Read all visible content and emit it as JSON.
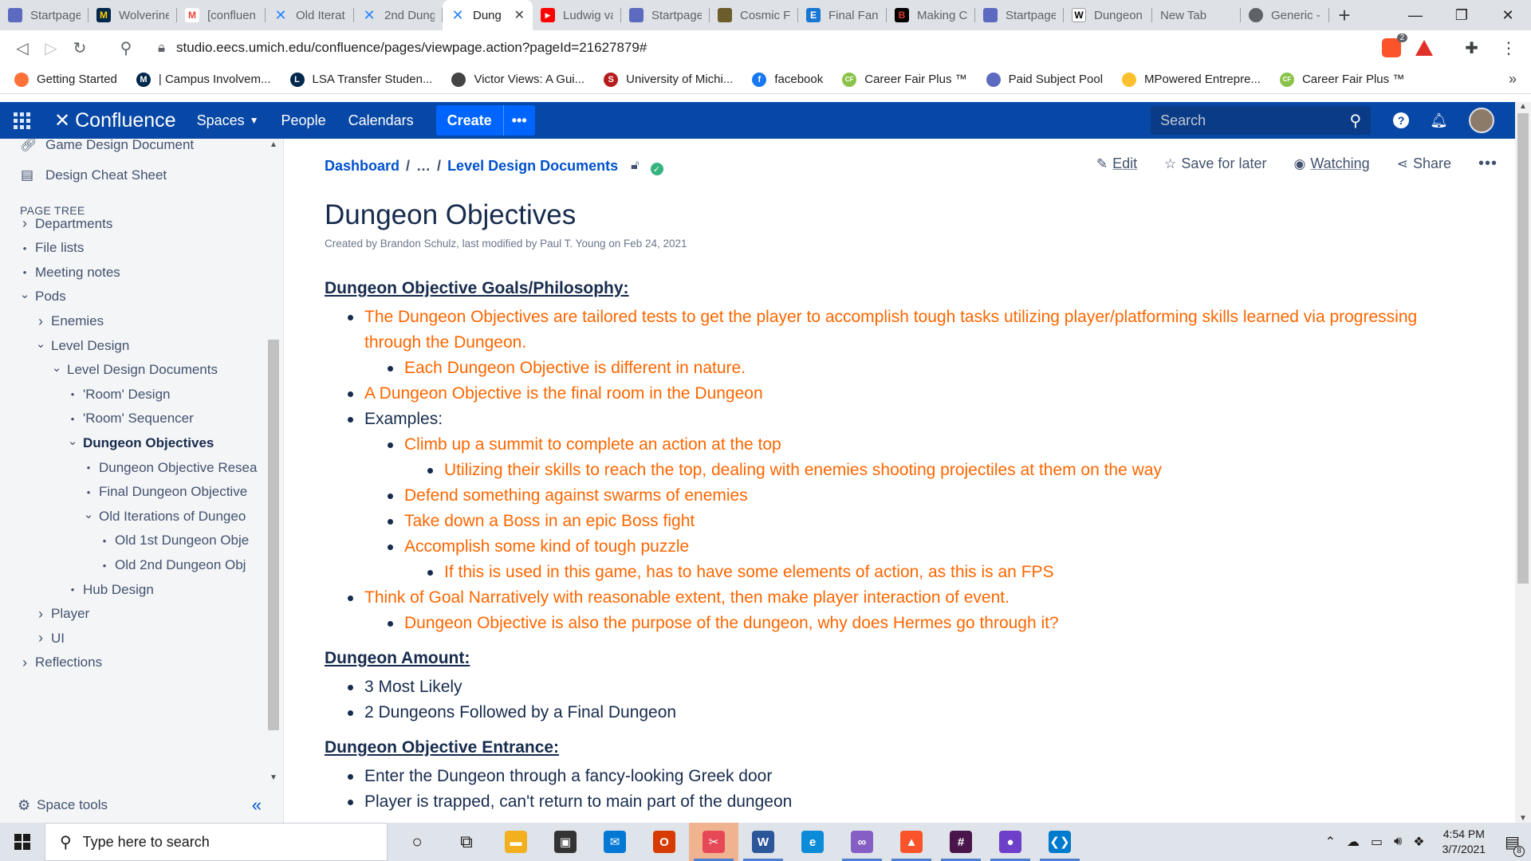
{
  "browser": {
    "tabs": [
      {
        "label": "Startpage",
        "icon": "startpage-icon",
        "color": "#5c6bc0"
      },
      {
        "label": "Wolverine",
        "icon": "michigan-icon",
        "color": "#00274c"
      },
      {
        "label": "[confluen",
        "icon": "gmail-icon",
        "color": "#ea4335"
      },
      {
        "label": "Old Iterat",
        "icon": "confluence-icon",
        "color": "#2684ff"
      },
      {
        "label": "2nd Dung",
        "icon": "confluence-icon",
        "color": "#2684ff"
      },
      {
        "label": "Dung",
        "icon": "confluence-icon",
        "color": "#2684ff",
        "active": true
      },
      {
        "label": "Ludwig va",
        "icon": "youtube-icon",
        "color": "#ff0000"
      },
      {
        "label": "Startpage",
        "icon": "startpage-icon",
        "color": "#5c6bc0"
      },
      {
        "label": "Cosmic Fa",
        "icon": "cosmic-icon",
        "color": "#6d5d2c"
      },
      {
        "label": "Final Fant",
        "icon": "e-icon",
        "color": "#1976d2"
      },
      {
        "label": "Making C",
        "icon": "b-icon",
        "color": "#c62828"
      },
      {
        "label": "Startpage",
        "icon": "startpage-icon",
        "color": "#5c6bc0"
      },
      {
        "label": "Dungeon",
        "icon": "wikipedia-icon",
        "color": "#ffffff"
      },
      {
        "label": "New Tab",
        "icon": "",
        "color": ""
      },
      {
        "label": "Generic -",
        "icon": "globe-icon",
        "color": "#5f6368"
      }
    ],
    "close_glyph": "✕",
    "new_tab_glyph": "+",
    "window_controls": {
      "minimize": "—",
      "maximize": "❐",
      "close": "✕"
    },
    "url": "studio.eecs.umich.edu/confluence/pages/viewpage.action?pageId=21627879#",
    "brave_badge": "2",
    "bookmarks": [
      {
        "label": "Getting Started",
        "icon": "firefox-icon",
        "color": "#ff7139",
        "glyph": ""
      },
      {
        "label": "| Campus Involvem...",
        "icon": "michigan-icon",
        "color": "#00274c",
        "glyph": "M"
      },
      {
        "label": "LSA Transfer Studen...",
        "icon": "lsa-icon",
        "color": "#00274c",
        "glyph": "L"
      },
      {
        "label": "Victor Views: A Gui...",
        "icon": "globe-icon",
        "color": "#444444",
        "glyph": ""
      },
      {
        "label": "University of Michi...",
        "icon": "umich-icon",
        "color": "#b71c1c",
        "glyph": "S"
      },
      {
        "label": "facebook",
        "icon": "facebook-icon",
        "color": "#1877f2",
        "glyph": "f"
      },
      {
        "label": "Career Fair Plus ™",
        "icon": "careerfair-icon",
        "color": "#8bc34a",
        "glyph": "CF"
      },
      {
        "label": "Paid Subject Pool",
        "icon": "subjectpool-icon",
        "color": "#5c6bc0",
        "glyph": ""
      },
      {
        "label": "MPowered Entrepre...",
        "icon": "mpowered-icon",
        "color": "#fbc02d",
        "glyph": ""
      },
      {
        "label": "Career Fair Plus ™",
        "icon": "careerfair-icon",
        "color": "#8bc34a",
        "glyph": "CF"
      }
    ],
    "bookmarks_more": "»"
  },
  "confluence": {
    "logo_text": "Confluence",
    "nav": {
      "spaces": "Spaces",
      "people": "People",
      "calendars": "Calendars",
      "create": "Create",
      "create_more": "•••"
    },
    "search_placeholder": "Search",
    "brand_color": "#0747a6"
  },
  "sidebar": {
    "top_items": [
      {
        "label": "Game Design Document",
        "icon": "link-icon"
      },
      {
        "label": "Design Cheat Sheet",
        "icon": "document-icon"
      }
    ],
    "page_tree_heading": "PAGE TREE",
    "tree": [
      {
        "label": "Departments",
        "marker": "›",
        "depth": 0
      },
      {
        "label": "File lists",
        "marker": "•",
        "depth": 0
      },
      {
        "label": "Meeting notes",
        "marker": "•",
        "depth": 0
      },
      {
        "label": "Pods",
        "marker": "⌄",
        "depth": 0
      },
      {
        "label": "Enemies",
        "marker": "›",
        "depth": 1
      },
      {
        "label": "Level Design",
        "marker": "⌄",
        "depth": 1
      },
      {
        "label": "Level Design Documents",
        "marker": "⌄",
        "depth": 2
      },
      {
        "label": "'Room' Design",
        "marker": "•",
        "depth": 3
      },
      {
        "label": "'Room' Sequencer",
        "marker": "•",
        "depth": 3
      },
      {
        "label": "Dungeon Objectives",
        "marker": "⌄",
        "depth": 3,
        "current": true
      },
      {
        "label": "Dungeon Objective Resea",
        "marker": "•",
        "depth": 4
      },
      {
        "label": "Final Dungeon Objective",
        "marker": "•",
        "depth": 4
      },
      {
        "label": "Old Iterations of Dungeo",
        "marker": "⌄",
        "depth": 4
      },
      {
        "label": "Old 1st Dungeon Obje",
        "marker": "•",
        "depth": 5
      },
      {
        "label": "Old 2nd Dungeon Obj",
        "marker": "•",
        "depth": 5
      },
      {
        "label": "Hub Design",
        "marker": "•",
        "depth": 3
      },
      {
        "label": "Player",
        "marker": "›",
        "depth": 1
      },
      {
        "label": "UI",
        "marker": "›",
        "depth": 1
      },
      {
        "label": "Reflections",
        "marker": "›",
        "depth": 0
      }
    ],
    "space_tools": "Space tools",
    "collapse_glyph": "«"
  },
  "page": {
    "breadcrumbs": [
      {
        "label": "Dashboard"
      },
      {
        "label": "…"
      },
      {
        "label": "Level Design Documents"
      }
    ],
    "actions": {
      "edit": "Edit",
      "save": "Save for later",
      "watch": "Watching",
      "share": "Share",
      "more": "•••"
    },
    "title": "Dungeon Objectives",
    "byline": "Created by Brandon Schulz, last modified by Paul T. Young on Feb 24, 2021",
    "sections": [
      {
        "heading": "Dungeon Objective Goals/Philosophy:",
        "items": [
          {
            "text": "The Dungeon Objectives are tailored tests to get the player to accomplish tough tasks utilizing player/platforming skills learned via progressing through the Dungeon.",
            "level": 1,
            "color": "orange"
          },
          {
            "text": "Each Dungeon Objective is different in nature.",
            "level": 2,
            "color": "orange"
          },
          {
            "text": "A Dungeon Objective is the final room in the Dungeon",
            "level": 1,
            "color": "orange"
          },
          {
            "text": "Examples:",
            "level": 1,
            "color": "dark"
          },
          {
            "text": "Climb up a summit to complete an action at the top",
            "level": 2,
            "color": "orange"
          },
          {
            "text": "Utilizing their skills to reach the top, dealing with enemies shooting projectiles at them on the way",
            "level": 3,
            "color": "orange"
          },
          {
            "text": "Defend something against swarms of enemies",
            "level": 2,
            "color": "orange"
          },
          {
            "text": "Take down a Boss in an epic Boss fight",
            "level": 2,
            "color": "orange"
          },
          {
            "text": "Accomplish some kind of tough puzzle",
            "level": 2,
            "color": "orange"
          },
          {
            "text": "If this is used in this game, has to have some elements of action, as this is an FPS",
            "level": 3,
            "color": "orange"
          },
          {
            "text": "Think of Goal Narratively with reasonable extent, then make player interaction of event.",
            "level": 1,
            "color": "orange"
          },
          {
            "text": "Dungeon Objective is also the purpose of the dungeon, why does Hermes go through it?",
            "level": 2,
            "color": "orange"
          }
        ]
      },
      {
        "heading": "Dungeon Amount:",
        "items": [
          {
            "text": "3 Most Likely",
            "level": 1,
            "color": "dark"
          },
          {
            "text": "2 Dungeons Followed by a Final Dungeon",
            "level": 1,
            "color": "dark"
          }
        ]
      },
      {
        "heading": "Dungeon Objective Entrance:",
        "items": [
          {
            "text": "Enter the Dungeon through a fancy-looking Greek door",
            "level": 1,
            "color": "dark"
          },
          {
            "text": "Player is trapped, can't return to main part of the dungeon",
            "level": 1,
            "color": "dark"
          }
        ]
      }
    ]
  },
  "taskbar": {
    "search_placeholder": "Type here to search",
    "apps": [
      {
        "icon": "cortana-icon",
        "color": "#1b1b1b",
        "glyph": "○"
      },
      {
        "icon": "task-view-icon",
        "color": "#1b1b1b",
        "glyph": "⧉"
      },
      {
        "icon": "file-explorer-icon",
        "color": "#f2b01e",
        "glyph": "▬"
      },
      {
        "icon": "store-icon",
        "color": "#333333",
        "glyph": "▣"
      },
      {
        "icon": "mail-icon",
        "color": "#0078d4",
        "glyph": "✉"
      },
      {
        "icon": "office-icon",
        "color": "#d83b01",
        "glyph": "O"
      },
      {
        "icon": "snip-icon",
        "color": "#e74856",
        "glyph": "✂"
      },
      {
        "icon": "word-icon",
        "color": "#2b579a",
        "glyph": "W"
      },
      {
        "icon": "edge-icon",
        "color": "#0c8bd8",
        "glyph": "e"
      },
      {
        "icon": "visual-studio-icon",
        "color": "#865fc5",
        "glyph": "∞"
      },
      {
        "icon": "brave-icon",
        "color": "#fb542b",
        "glyph": "▲"
      },
      {
        "icon": "slack-icon",
        "color": "#4a154b",
        "glyph": "#"
      },
      {
        "icon": "github-icon",
        "color": "#6e40c9",
        "glyph": "●"
      },
      {
        "icon": "vscode-icon",
        "color": "#007acc",
        "glyph": "❮❯"
      }
    ],
    "time": "4:54 PM",
    "date": "3/7/2021",
    "notifications": "8"
  }
}
